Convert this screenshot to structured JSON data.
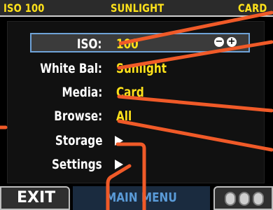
{
  "status_bar": {
    "iso": "ISO 100",
    "white_balance": "SUNLIGHT",
    "media": "CARD"
  },
  "menu": {
    "iso": {
      "label": "ISO:",
      "value": "100"
    },
    "white_balance": {
      "label": "White Bal:",
      "value": "Sunlight"
    },
    "media": {
      "label": "Media:",
      "value": "Card"
    },
    "browse": {
      "label": "Browse:",
      "value": "All"
    },
    "storage": {
      "label": "Storage"
    },
    "settings": {
      "label": "Settings"
    }
  },
  "iso_controls": {
    "minus": "−",
    "plus": "+"
  },
  "bottom_bar": {
    "exit": "EXIT",
    "title": "MAIN MENU"
  },
  "colors": {
    "accent": "#ffe21a",
    "annotation": "#f05a28",
    "selection": "#6fa3d8"
  }
}
